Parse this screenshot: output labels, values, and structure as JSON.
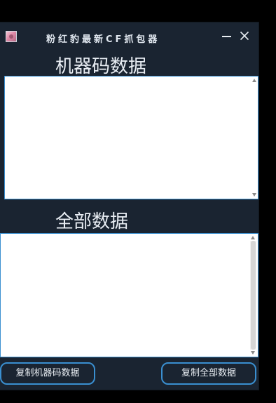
{
  "window": {
    "title": "粉红豹最新CF抓包器",
    "app_icon": "pink-panther-app-icon",
    "minimize_glyph": "—",
    "close_glyph": "✕"
  },
  "sections": {
    "machine_code": {
      "label": "机器码数据",
      "value": ""
    },
    "all_data": {
      "label": "全部数据",
      "value": ""
    }
  },
  "buttons": {
    "copy_machine_code": "复制机器码数据",
    "copy_all_data": "复制全部数据"
  },
  "colors": {
    "background": "#1a2431",
    "accent_border": "#3a8fd0",
    "text": "#e9eef4"
  }
}
